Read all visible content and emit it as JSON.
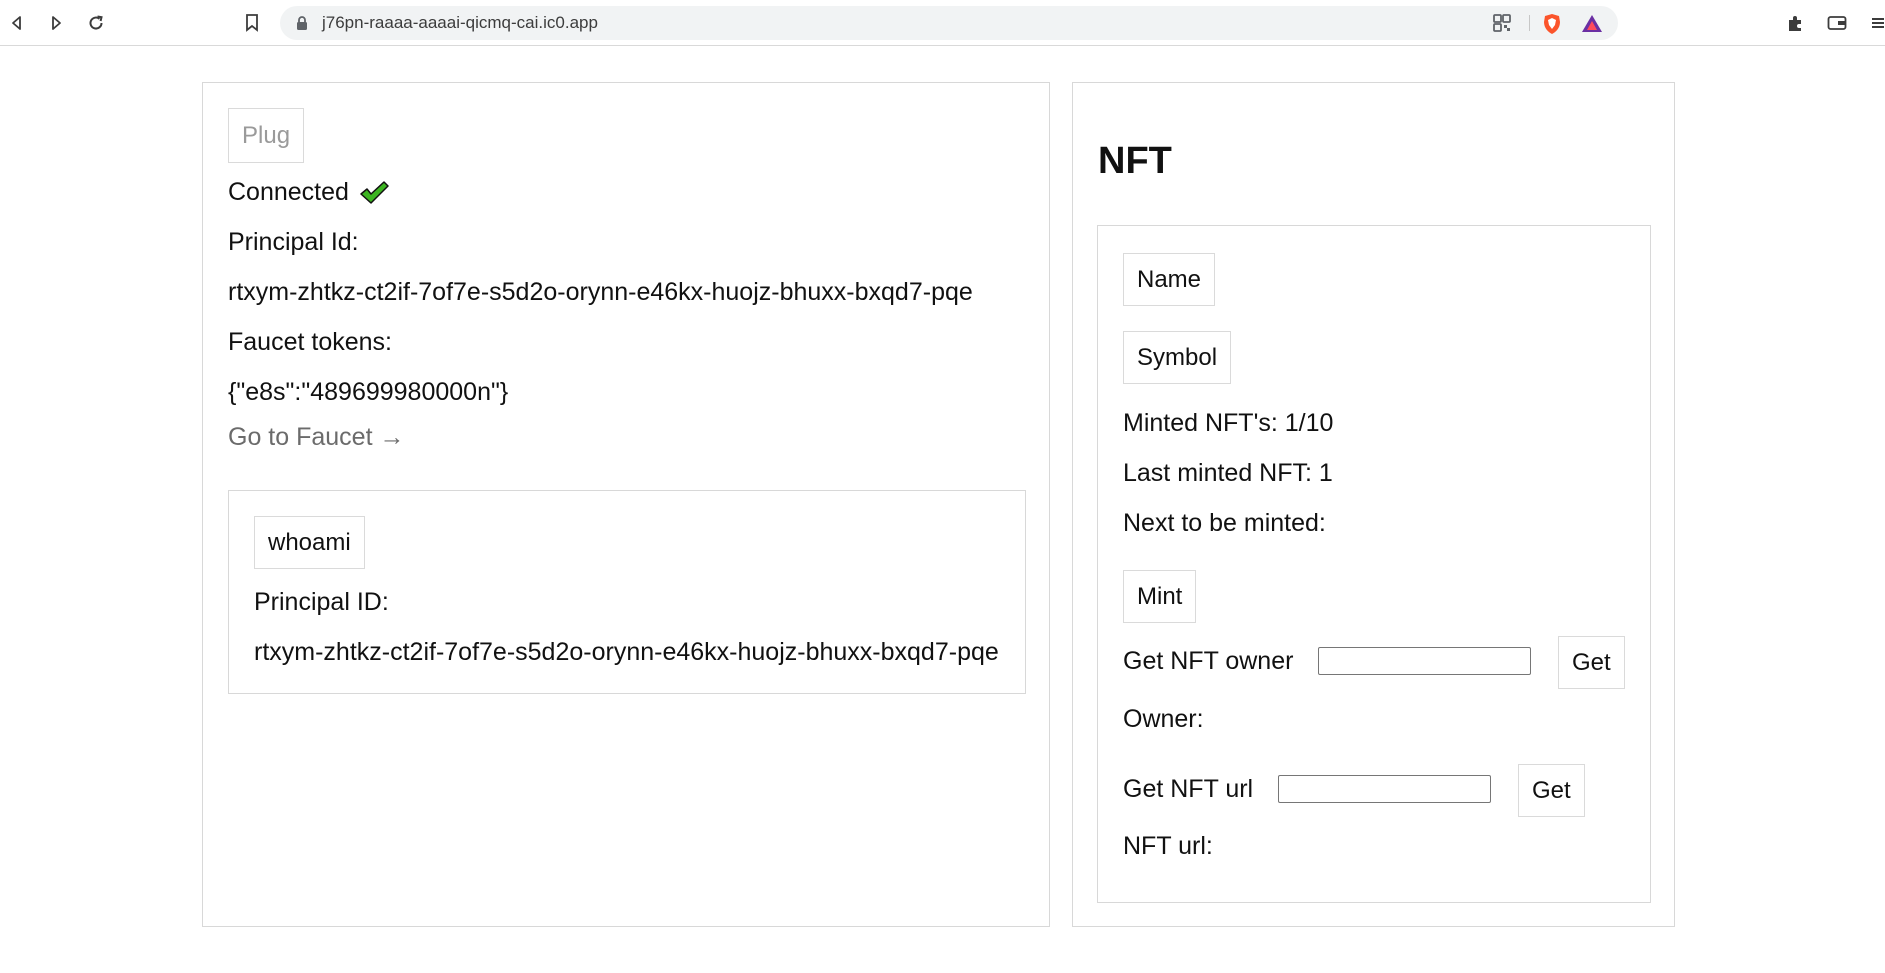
{
  "browser": {
    "url": "j76pn-raaaa-aaaai-qicmq-cai.ic0.app",
    "icons": [
      "back-icon",
      "forward-icon",
      "reload-icon",
      "bookmark-icon",
      "lock-icon",
      "qr-icon",
      "brave-shield-icon",
      "brave-rewards-icon",
      "extensions-icon",
      "wallet-icon",
      "menu-icon"
    ]
  },
  "left": {
    "plug_button": "Plug",
    "connected_label": "Connected",
    "principal_label": "Principal Id:",
    "principal_value": "rtxym-zhtkz-ct2if-7of7e-s5d2o-orynn-e46kx-huojz-bhuxx-bxqd7-pqe",
    "faucet_label": "Faucet tokens:",
    "faucet_value": "{\"e8s\":\"489699980000n\"}",
    "faucet_link": "Go to Faucet →",
    "whoami": {
      "button": "whoami",
      "label": "Principal ID:",
      "value": "rtxym-zhtkz-ct2if-7of7e-s5d2o-orynn-e46kx-huojz-bhuxx-bxqd7-pqe"
    }
  },
  "right": {
    "title": "NFT",
    "name_button": "Name",
    "symbol_button": "Symbol",
    "minted": "Minted NFT's: 1/10",
    "last_minted": "Last minted NFT: 1",
    "next_minted": "Next to be minted:",
    "mint_button": "Mint",
    "owner": {
      "label": "Get NFT owner",
      "input_value": "",
      "button": "Get",
      "result_label": "Owner:"
    },
    "url": {
      "label": "Get NFT url",
      "input_value": "",
      "button": "Get",
      "result_label": "NFT url:"
    }
  },
  "colors": {
    "check_green": "#3cb521",
    "border": "#d8d8d8",
    "link": "#6b6b6b"
  }
}
